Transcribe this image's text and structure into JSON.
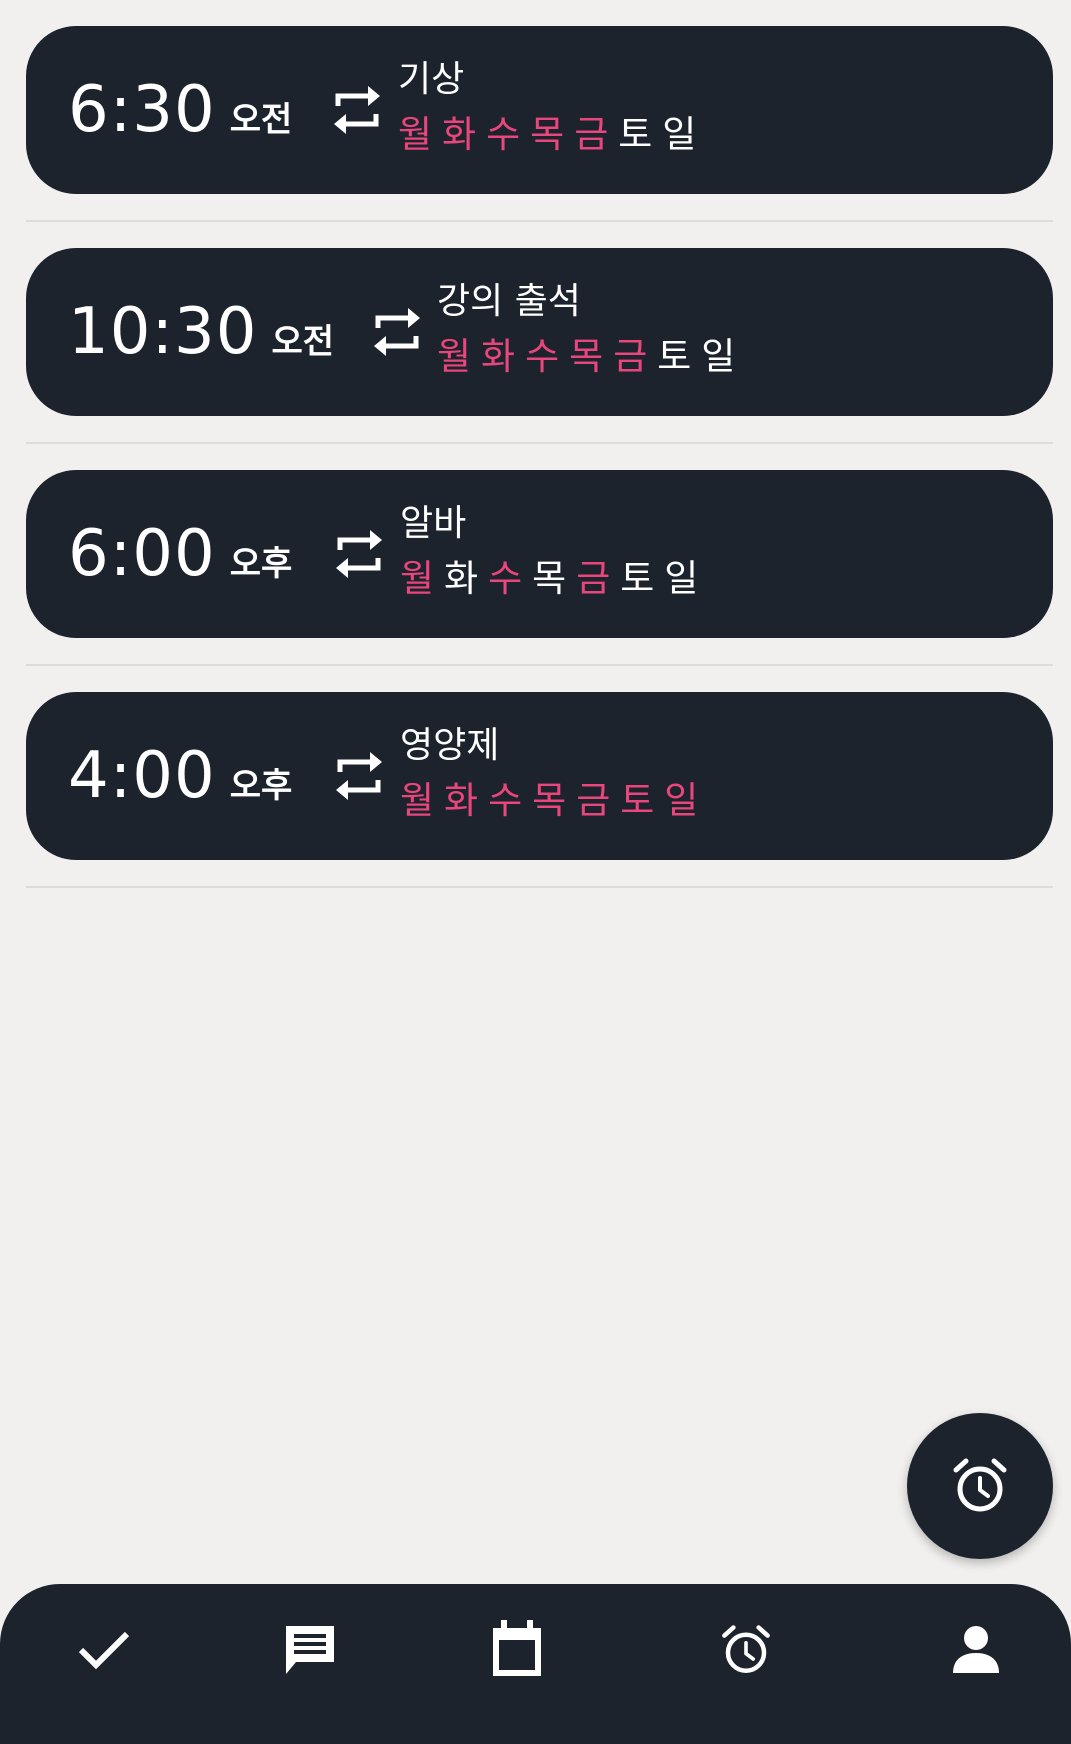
{
  "alarms": [
    {
      "hm": "6:30",
      "ampm": "오전",
      "label": "기상",
      "days": [
        {
          "d": "월",
          "on": true
        },
        {
          "d": "화",
          "on": true
        },
        {
          "d": "수",
          "on": true
        },
        {
          "d": "목",
          "on": true
        },
        {
          "d": "금",
          "on": true
        },
        {
          "d": "토",
          "on": false
        },
        {
          "d": "일",
          "on": false
        }
      ]
    },
    {
      "hm": "10:30",
      "ampm": "오전",
      "label": "강의 출석",
      "days": [
        {
          "d": "월",
          "on": true
        },
        {
          "d": "화",
          "on": true
        },
        {
          "d": "수",
          "on": true
        },
        {
          "d": "목",
          "on": true
        },
        {
          "d": "금",
          "on": true
        },
        {
          "d": "토",
          "on": false
        },
        {
          "d": "일",
          "on": false
        }
      ]
    },
    {
      "hm": "6:00",
      "ampm": "오후",
      "label": "알바",
      "days": [
        {
          "d": "월",
          "on": true
        },
        {
          "d": "화",
          "on": false
        },
        {
          "d": "수",
          "on": true
        },
        {
          "d": "목",
          "on": false
        },
        {
          "d": "금",
          "on": true
        },
        {
          "d": "토",
          "on": false
        },
        {
          "d": "일",
          "on": false
        }
      ]
    },
    {
      "hm": "4:00",
      "ampm": "오후",
      "label": "영양제",
      "days": [
        {
          "d": "월",
          "on": true
        },
        {
          "d": "화",
          "on": true
        },
        {
          "d": "수",
          "on": true
        },
        {
          "d": "목",
          "on": true
        },
        {
          "d": "금",
          "on": true
        },
        {
          "d": "토",
          "on": true
        },
        {
          "d": "일",
          "on": true
        }
      ]
    }
  ],
  "colors": {
    "card_bg": "#1c232d",
    "active_day": "#e8467c",
    "inactive_day": "#ffffff",
    "background": "#f1f0ee"
  },
  "fab": {
    "icon": "alarm-add-icon"
  },
  "bottom_nav": [
    {
      "icon": "check-icon"
    },
    {
      "icon": "chat-icon"
    },
    {
      "icon": "calendar-icon"
    },
    {
      "icon": "alarm-icon"
    },
    {
      "icon": "person-icon"
    }
  ]
}
